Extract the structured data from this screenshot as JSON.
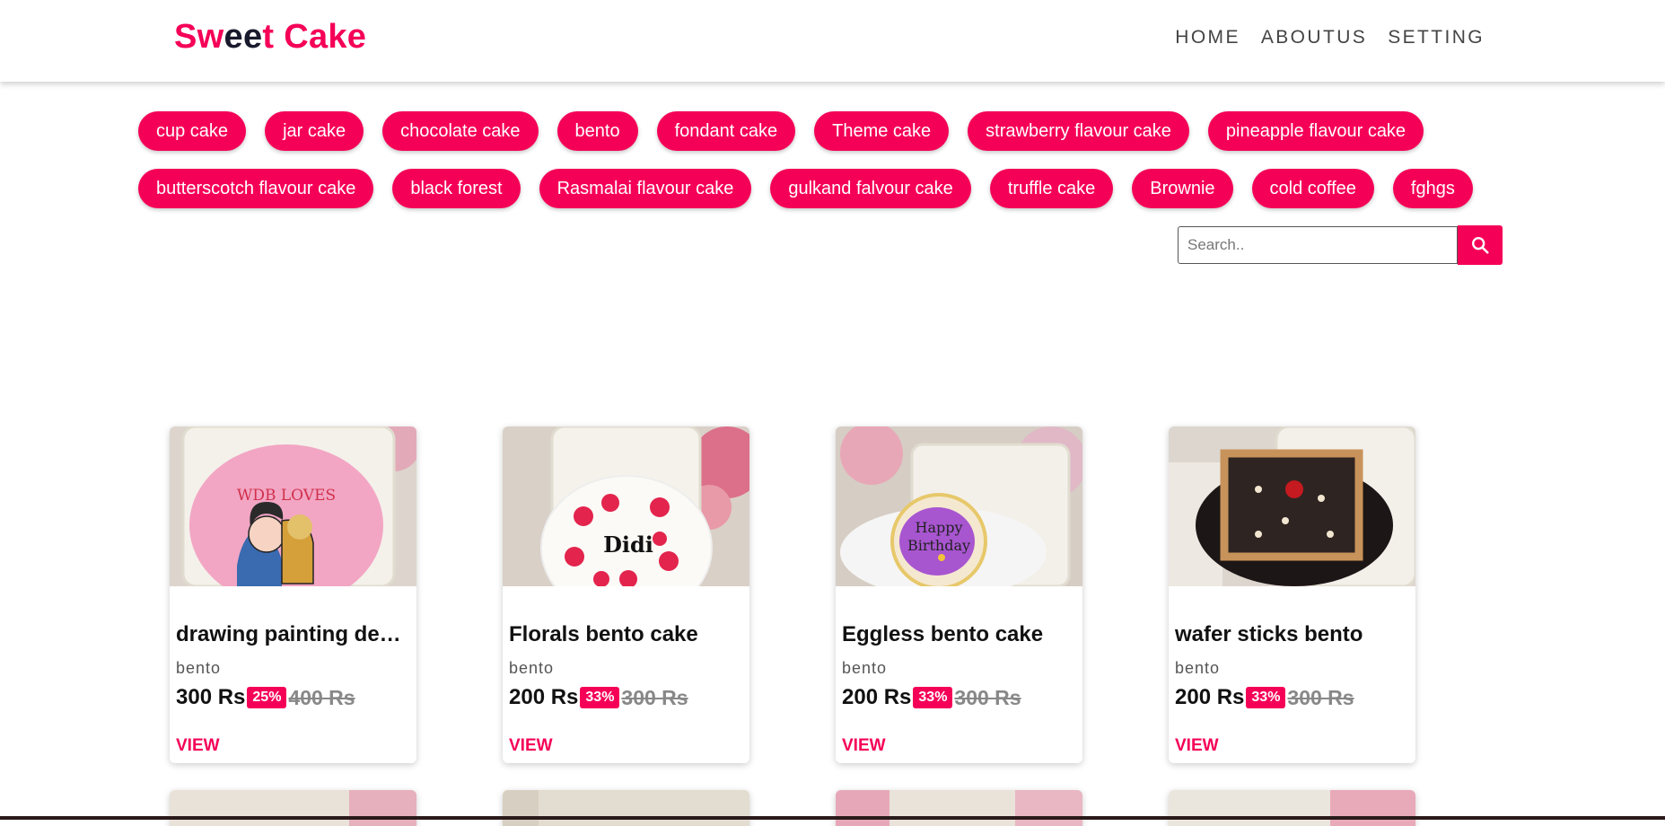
{
  "header": {
    "logo": {
      "part1": "Sw",
      "part2": "ee",
      "part3": "t Cake"
    },
    "nav": [
      "HOME",
      "ABOUTUS",
      "SETTING"
    ]
  },
  "categories": {
    "row1": [
      "cup cake",
      "jar cake",
      "chocolate cake",
      "bento",
      "fondant cake",
      "Theme cake",
      "strawberry flavour cake",
      "pineapple flavour cake"
    ],
    "row2": [
      "butterscotch flavour cake",
      "black forest",
      "Rasmalai flavour cake",
      "gulkand falvour cake",
      "truffle cake",
      "Brownie",
      "cold coffee",
      "fghgs"
    ]
  },
  "search": {
    "placeholder": "Search..",
    "icon": "search-icon"
  },
  "products": [
    {
      "title": "drawing painting desi...",
      "category": "bento",
      "price": "300 Rs",
      "discount": "25%",
      "original": "400 Rs",
      "view": "VIEW",
      "cake_text": "WDB LOVES"
    },
    {
      "title": "Florals bento cake",
      "category": "bento",
      "price": "200 Rs",
      "discount": "33%",
      "original": "300 Rs",
      "view": "VIEW",
      "cake_text": "Didi"
    },
    {
      "title": "Eggless bento cake",
      "category": "bento",
      "price": "200 Rs",
      "discount": "33%",
      "original": "300 Rs",
      "view": "VIEW",
      "cake_text_1": "Happy",
      "cake_text_2": "Birthday"
    },
    {
      "title": "wafer sticks bento",
      "category": "bento",
      "price": "200 Rs",
      "discount": "33%",
      "original": "300 Rs",
      "view": "VIEW"
    }
  ],
  "colors": {
    "accent": "#f50057",
    "logo_dark": "#1a1a2e"
  }
}
